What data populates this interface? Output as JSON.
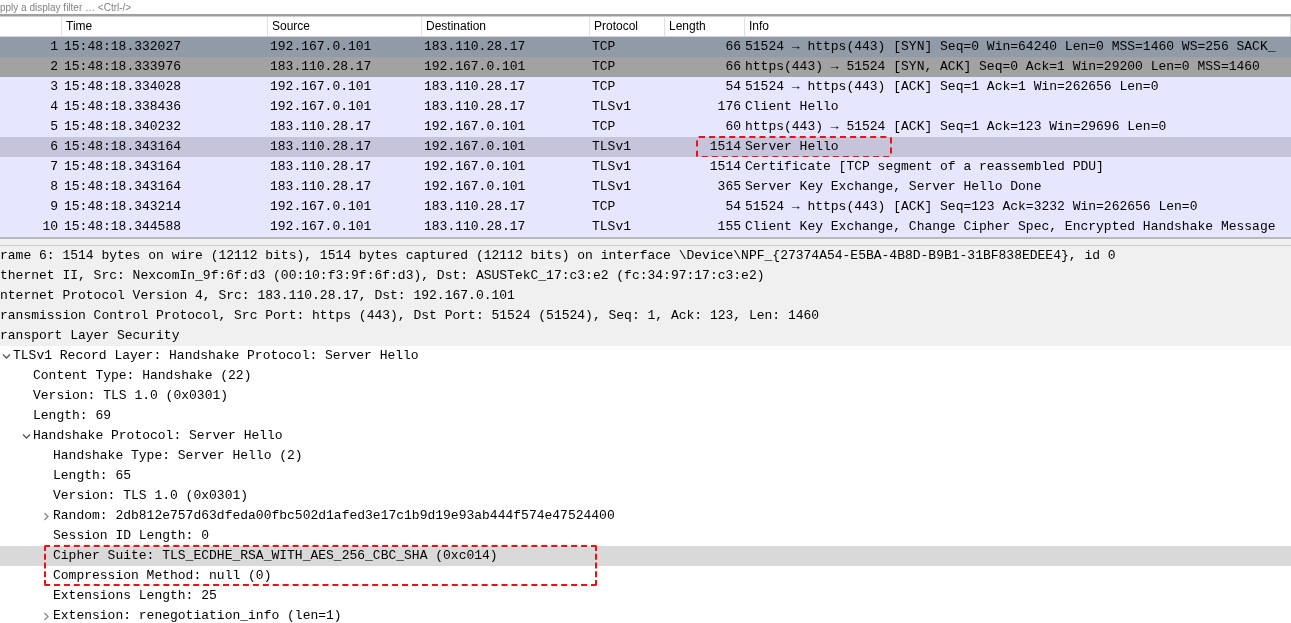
{
  "filter": {
    "placeholder": "pply a display filter … <Ctrl-/>"
  },
  "packet_list": {
    "columns": [
      "",
      "Time",
      "Source",
      "Destination",
      "Protocol",
      "Length",
      "Info"
    ],
    "rows": [
      {
        "no": "1",
        "time": "15:48:18.332027",
        "source": "192.167.0.101",
        "destination": "183.110.28.17",
        "protocol": "TCP",
        "length": "66",
        "info": "51524 → https(443) [SYN] Seq=0 Win=64240 Len=0 MSS=1460 WS=256 SACK_",
        "color": "#919ba7",
        "selected": false,
        "annotated": false
      },
      {
        "no": "2",
        "time": "15:48:18.333976",
        "source": "183.110.28.17",
        "destination": "192.167.0.101",
        "protocol": "TCP",
        "length": "66",
        "info": "https(443) → 51524 [SYN, ACK] Seq=0 Ack=1 Win=29200 Len=0 MSS=1460",
        "color": "#a2a2a2",
        "selected": false,
        "annotated": false
      },
      {
        "no": "3",
        "time": "15:48:18.334028",
        "source": "192.167.0.101",
        "destination": "183.110.28.17",
        "protocol": "TCP",
        "length": "54",
        "info": "51524 → https(443) [ACK] Seq=1 Ack=1 Win=262656 Len=0",
        "color": "#e7e6ff",
        "selected": false,
        "annotated": false
      },
      {
        "no": "4",
        "time": "15:48:18.338436",
        "source": "192.167.0.101",
        "destination": "183.110.28.17",
        "protocol": "TLSv1",
        "length": "176",
        "info": "Client Hello",
        "color": "#e7e6ff",
        "selected": false,
        "annotated": false
      },
      {
        "no": "5",
        "time": "15:48:18.340232",
        "source": "183.110.28.17",
        "destination": "192.167.0.101",
        "protocol": "TCP",
        "length": "60",
        "info": "https(443) → 51524 [ACK] Seq=1 Ack=123 Win=29696 Len=0",
        "color": "#e7e6ff",
        "selected": false,
        "annotated": false
      },
      {
        "no": "6",
        "time": "15:48:18.343164",
        "source": "183.110.28.17",
        "destination": "192.167.0.101",
        "protocol": "TLSv1",
        "length": "1514",
        "info": "Server Hello",
        "selected": true,
        "annotated": true
      },
      {
        "no": "7",
        "time": "15:48:18.343164",
        "source": "183.110.28.17",
        "destination": "192.167.0.101",
        "protocol": "TLSv1",
        "length": "1514",
        "info": "Certificate [TCP segment of a reassembled PDU]",
        "color": "#e7e6ff",
        "selected": false,
        "annotated": false
      },
      {
        "no": "8",
        "time": "15:48:18.343164",
        "source": "183.110.28.17",
        "destination": "192.167.0.101",
        "protocol": "TLSv1",
        "length": "365",
        "info": "Server Key Exchange, Server Hello Done",
        "color": "#e7e6ff",
        "selected": false,
        "annotated": false
      },
      {
        "no": "9",
        "time": "15:48:18.343214",
        "source": "192.167.0.101",
        "destination": "183.110.28.17",
        "protocol": "TCP",
        "length": "54",
        "info": "51524 → https(443) [ACK] Seq=123 Ack=3232 Win=262656 Len=0",
        "color": "#e7e6ff",
        "selected": false,
        "annotated": false
      },
      {
        "no": "10",
        "time": "15:48:18.344588",
        "source": "192.167.0.101",
        "destination": "183.110.28.17",
        "protocol": "TLSv1",
        "length": "155",
        "info": "Client Key Exchange, Change Cipher Spec, Encrypted Handshake Message",
        "color": "#e7e6ff",
        "selected": false,
        "annotated": false
      }
    ]
  },
  "packet_details": [
    {
      "text": "rame 6: 1514 bytes on wire (12112 bits), 1514 bytes captured (12112 bits) on interface \\Device\\NPF_{27374A54-E5BA-4B8D-B9B1-31BF838EDEE4}, id 0",
      "selected": false
    },
    {
      "text": "thernet II, Src: NexcomIn_9f:6f:d3 (00:10:f3:9f:6f:d3), Dst: ASUSTekC_17:c3:e2 (fc:34:97:17:c3:e2)",
      "selected": false
    },
    {
      "text": "nternet Protocol Version 4, Src: 183.110.28.17, Dst: 192.167.0.101",
      "selected": false
    },
    {
      "text": "ransmission Control Protocol, Src Port: https (443), Dst Port: 51524 (51524), Seq: 1, Ack: 123, Len: 1460",
      "selected": false
    },
    {
      "text": "ransport Layer Security",
      "selected": false,
      "children": [
        {
          "text": "TLSv1 Record Layer: Handshake Protocol: Server Hello",
          "expanded": true,
          "selected": false,
          "children": [
            {
              "text": "Content Type: Handshake (22)",
              "selected": false
            },
            {
              "text": "Version: TLS 1.0 (0x0301)",
              "selected": false
            },
            {
              "text": "Length: 69",
              "selected": false
            },
            {
              "text": "Handshake Protocol: Server Hello",
              "expanded": true,
              "selected": false,
              "children": [
                {
                  "text": "Handshake Type: Server Hello (2)",
                  "selected": false
                },
                {
                  "text": "Length: 65",
                  "selected": false
                },
                {
                  "text": "Version: TLS 1.0 (0x0301)",
                  "selected": false
                },
                {
                  "text": "Random: 2db812e757d63dfeda00fbc502d1afed3e17c1b9d19e93ab444f574e47524400",
                  "expanded": false,
                  "selected": false
                },
                {
                  "text": "Session ID Length: 0",
                  "selected": false
                },
                {
                  "text": "Cipher Suite: TLS_ECDHE_RSA_WITH_AES_256_CBC_SHA (0xc014)",
                  "selected": true,
                  "annotated": true
                },
                {
                  "text": "Compression Method: null (0)",
                  "selected": false,
                  "annotated": true
                },
                {
                  "text": "Extensions Length: 25",
                  "selected": false
                },
                {
                  "text": "Extension: renegotiation_info (len=1)",
                  "expanded": false,
                  "selected": false
                }
              ]
            }
          ]
        }
      ]
    }
  ]
}
